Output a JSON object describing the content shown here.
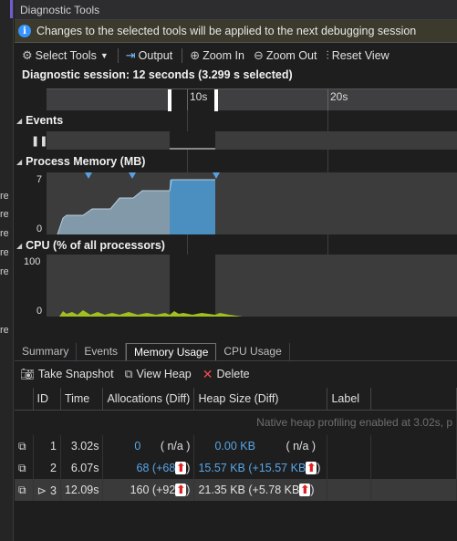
{
  "window": {
    "title": "Diagnostic Tools"
  },
  "infobar": {
    "message": "Changes to the selected tools will be applied to the next debugging session"
  },
  "toolbar": {
    "select_tools": "Select Tools",
    "output": "Output",
    "zoom_in": "Zoom In",
    "zoom_out": "Zoom Out",
    "reset_view": "Reset View"
  },
  "session": {
    "label": "Diagnostic session: 12 seconds (3.299 s selected)"
  },
  "timeline": {
    "tick_10s": "10s",
    "tick_20s": "20s"
  },
  "events": {
    "title": "Events"
  },
  "memory": {
    "title": "Process Memory (MB)",
    "max": "7",
    "min": "0"
  },
  "cpu": {
    "title": "CPU (% of all processors)",
    "max": "100",
    "min": "0"
  },
  "tabs": [
    "Summary",
    "Events",
    "Memory Usage",
    "CPU Usage"
  ],
  "actions": {
    "snapshot": "Take Snapshot",
    "view_heap": "View Heap",
    "delete": "Delete"
  },
  "table": {
    "headers": [
      "ID",
      "Time",
      "Allocations (Diff)",
      "Heap Size (Diff)",
      "Label"
    ],
    "note": "Native heap profiling enabled at 3.02s, p",
    "rows": [
      {
        "id": "1",
        "time": "3.02s",
        "alloc": "0",
        "alloc_diff": "( n/a )",
        "heap": "0.00 KB",
        "heap_diff": "( n/a )"
      },
      {
        "id": "2",
        "time": "6.07s",
        "alloc": "68",
        "alloc_diff": "(+68",
        "heap": "15.57 KB",
        "heap_diff": "(+15.57 KB"
      },
      {
        "id": "3",
        "time": "12.09s",
        "alloc": "160",
        "alloc_diff": "(+92",
        "heap": "21.35 KB",
        "heap_diff": "(+5.78 KB"
      }
    ],
    "close_paren": ")"
  },
  "left_strip": [
    "re",
    "re",
    "re",
    "re",
    "re",
    "re"
  ]
}
